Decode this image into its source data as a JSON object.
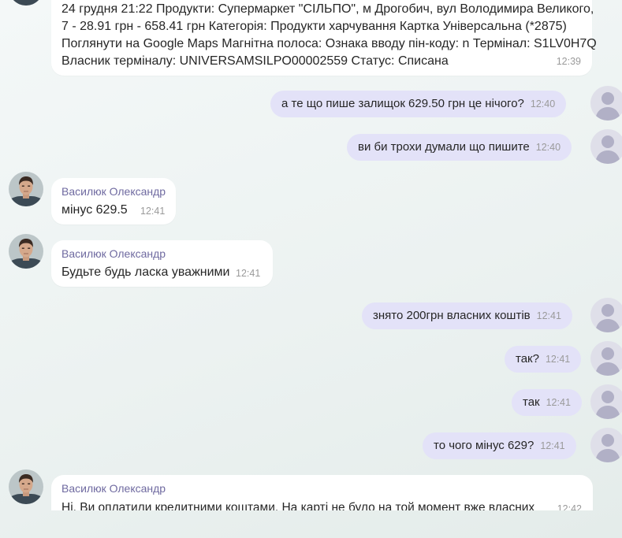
{
  "messages": [
    {
      "lines": [
        "24 грудня 21:22 Продукти: Супермаркет \"СІЛЬПО\", м Дрогобич, вул Володимира Великого,",
        "7 - 28.91 грн - 658.41 грн Категорія: Продукти харчування Картка Універсальна (*2875)",
        "Поглянути на Google Maps Магнітна полоса: Ознака вводу пін-коду: n Термінал: S1LV0H7Q",
        "Власник терміналу: UNIVERSAMSILPO00002559 Статус: Списана"
      ],
      "time": "12:39"
    },
    {
      "text": "а те що пише залищок 629.50 грн це нічого?",
      "time": "12:40"
    },
    {
      "text": "ви би трохи думали що пишите",
      "time": "12:40"
    },
    {
      "sender": "Василюк Олександр",
      "text": "мінус 629.5",
      "time": "12:41"
    },
    {
      "sender": "Василюк Олександр",
      "text": "Будьте будь ласка уважними",
      "time": "12:41"
    },
    {
      "text": "знято 200грн власних коштів",
      "time": "12:41"
    },
    {
      "text": "так?",
      "time": "12:41"
    },
    {
      "text": "так",
      "time": "12:41"
    },
    {
      "text": "то чого мінус 629?",
      "time": "12:41"
    },
    {
      "sender": "Василюк Олександр",
      "text": "Ні. Ви оплатили кредитними коштами. На карті не було на той момент вже власних",
      "time": "12:42"
    }
  ],
  "colors": {
    "incoming_bubble": "#ffffff",
    "outgoing_bubble": "#e3e2f8",
    "sender_name": "#6f6aa0",
    "timestamp": "#9a9a9a"
  }
}
